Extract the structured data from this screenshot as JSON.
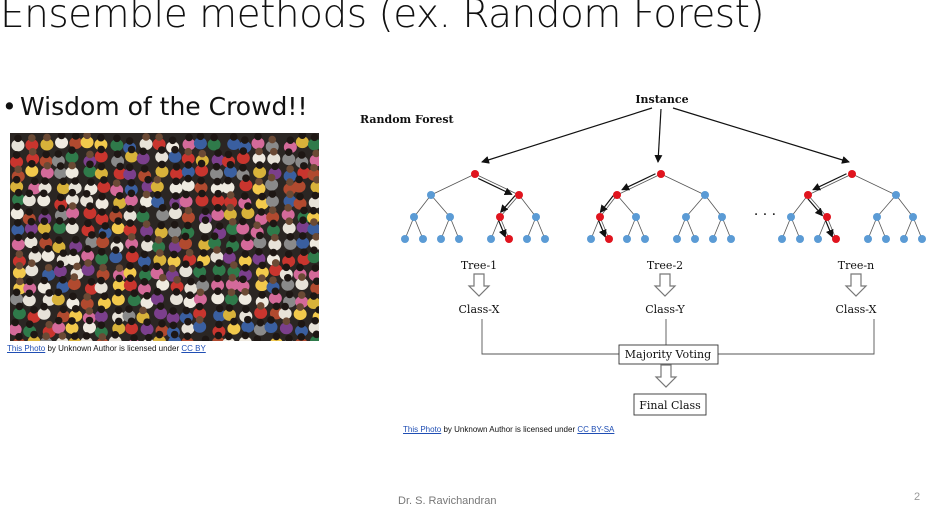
{
  "slide": {
    "title": "Ensemble methods (ex. Random Forest)",
    "bullet": "Wisdom of the Crowd!!",
    "footer": "Dr. S. Ravichandran",
    "page_number": "2"
  },
  "photo_credit_left": {
    "link_text": "This Photo",
    "middle_text": " by Unknown Author is licensed under ",
    "license": "CC BY"
  },
  "photo_credit_right": {
    "link_text": "This Photo",
    "middle_text": " by Unknown Author is licensed under ",
    "license": "CC BY-SA"
  },
  "diagram": {
    "heading": "Random Forest",
    "root_label": "Instance",
    "ellipsis": "· · ·",
    "trees": [
      {
        "label": "Tree-1",
        "class": "Class-X"
      },
      {
        "label": "Tree-2",
        "class": "Class-Y"
      },
      {
        "label": "Tree-n",
        "class": "Class-X"
      }
    ],
    "voting_label": "Majority Voting",
    "final_label": "Final Class",
    "colors": {
      "selected_node": "#e0141e",
      "node": "#5b9bd5",
      "edge": "#555555",
      "crowd_background": "#2b2623"
    }
  }
}
